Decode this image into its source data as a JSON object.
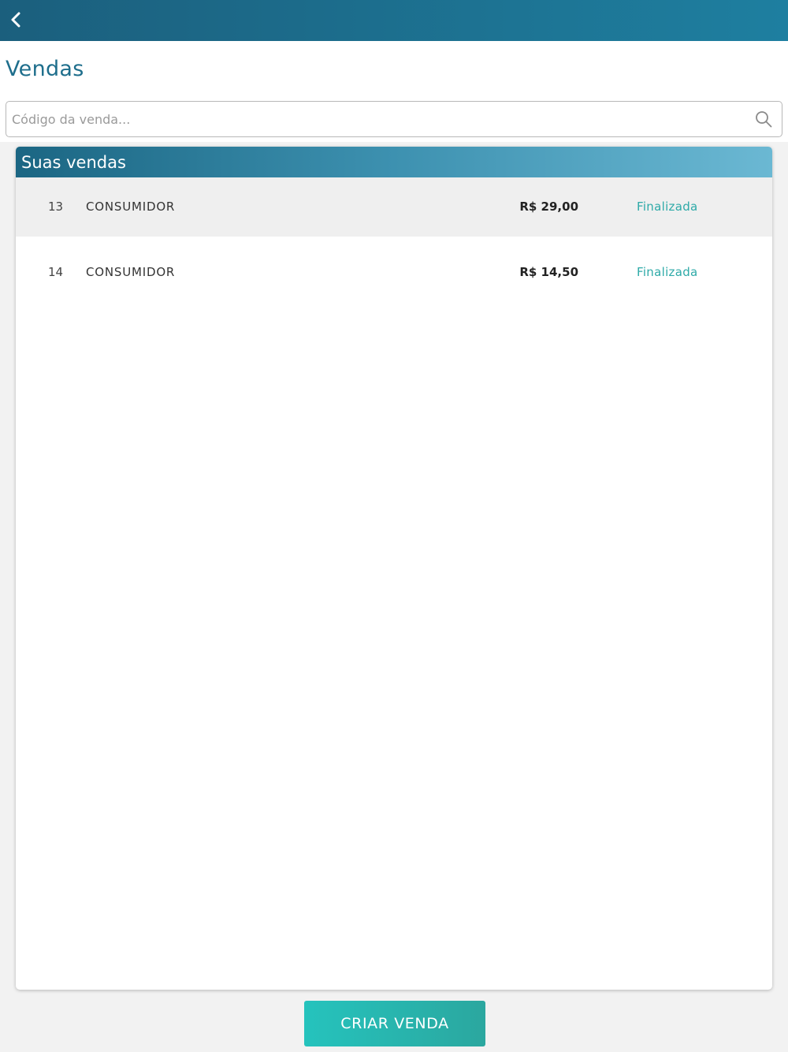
{
  "header": {
    "back_icon": "chevron-left-icon",
    "title": "Vendas"
  },
  "search": {
    "placeholder": "Código da venda...",
    "value": "",
    "icon": "search-icon"
  },
  "sales_panel": {
    "title": "Suas vendas",
    "rows": [
      {
        "code": "13",
        "client": "CONSUMIDOR",
        "value": "R$ 29,00",
        "status": "Finalizada"
      },
      {
        "code": "14",
        "client": "CONSUMIDOR",
        "value": "R$ 14,50",
        "status": "Finalizada"
      }
    ]
  },
  "footer": {
    "create_label": "CRIAR VENDA"
  },
  "colors": {
    "topbar": "#1b5f7d",
    "title": "#1e6e8c",
    "status": "#2eaaa8",
    "button": "#25c3bd"
  }
}
